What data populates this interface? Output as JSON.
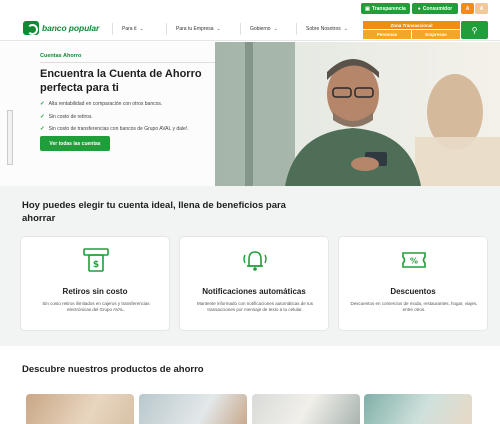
{
  "topbar": {
    "transparency": "Transparencia",
    "consumer": "Consumidor",
    "font_small": "A",
    "font_large": "A"
  },
  "header": {
    "brand": "banco popular",
    "nav": [
      {
        "label": "Para ti"
      },
      {
        "label": "Para tu Empresa"
      },
      {
        "label": "Gobierno"
      },
      {
        "label": "Sobre Nosotros"
      }
    ],
    "zone_title": "Zona Transaccional",
    "zone_tabs": [
      "Personas",
      "Empresas"
    ]
  },
  "hero": {
    "eyebrow": "Cuentas Ahorro",
    "title": "Encuentra la Cuenta de Ahorro perfecta para ti",
    "bullets": [
      "Alta rentabilidad en comparación con otros bancos.",
      "Sin costo de retiros.",
      "Sin costo de transferencias con bancos de Grupo AVAL y dale!."
    ],
    "cta": "Ver todas las cuentas"
  },
  "benefits": {
    "title": "Hoy puedes elegir tu cuenta ideal, llena de beneficios para ahorrar",
    "cards": [
      {
        "icon": "atm-cash-icon",
        "title": "Retiros sin costo",
        "desc": "Sin costo retiros ilimitados en cajeros y transferencias electrónicas del Grupo AVAL."
      },
      {
        "icon": "bell-notification-icon",
        "title": "Notificaciones automáticas",
        "desc": "Mantente informado con notificaciones automáticas de tus transacciones por mensaje de texto a tu celular."
      },
      {
        "icon": "discount-ticket-icon",
        "title": "Descuentos",
        "desc": "Descuentos en comercios de moda, restaurantes, hogar, viajes, entre otros."
      }
    ]
  },
  "products": {
    "title": "Descubre nuestros productos de ahorro"
  },
  "colors": {
    "brand_green": "#1f9e3a",
    "accent_orange": "#f28c14"
  }
}
